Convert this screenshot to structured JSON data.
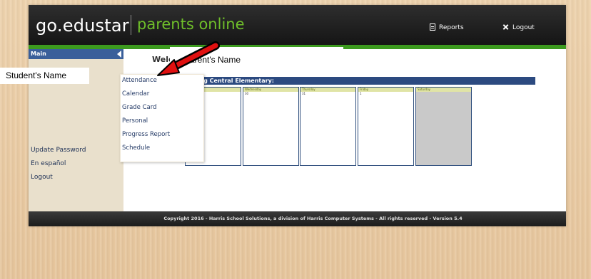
{
  "header": {
    "brand": "go.edustar",
    "brand_sub": "parents online",
    "reports_label": "Reports",
    "logout_label": "Logout",
    "accent_green": "#3c9a1e"
  },
  "sidebar": {
    "main_label": "Main",
    "student_label": "Student's Name",
    "links": [
      "Update Password",
      "En español",
      "Logout"
    ]
  },
  "main": {
    "welcome": "Welcom",
    "parent_label": "Parent's Name",
    "school_title": "sburg Central Elementary:",
    "calendar": [
      {
        "day": "",
        "num": ""
      },
      {
        "day": "Wednesday",
        "num": "30"
      },
      {
        "day": "Thursday",
        "num": "31"
      },
      {
        "day": "Friday",
        "num": "1"
      },
      {
        "day": "Saturday",
        "num": ""
      }
    ]
  },
  "dropdown": {
    "items": [
      "Attendance",
      "Calendar",
      "Grade Card",
      "Personal",
      "Progress Report",
      "Schedule"
    ]
  },
  "footer": {
    "text": "Copyright 2016 - Harris School Solutions, a division of Harris Computer Systems - All rights reserved - Version 5.4"
  },
  "icons": [
    "reports-icon",
    "logout-icon",
    "arrow-icon"
  ]
}
